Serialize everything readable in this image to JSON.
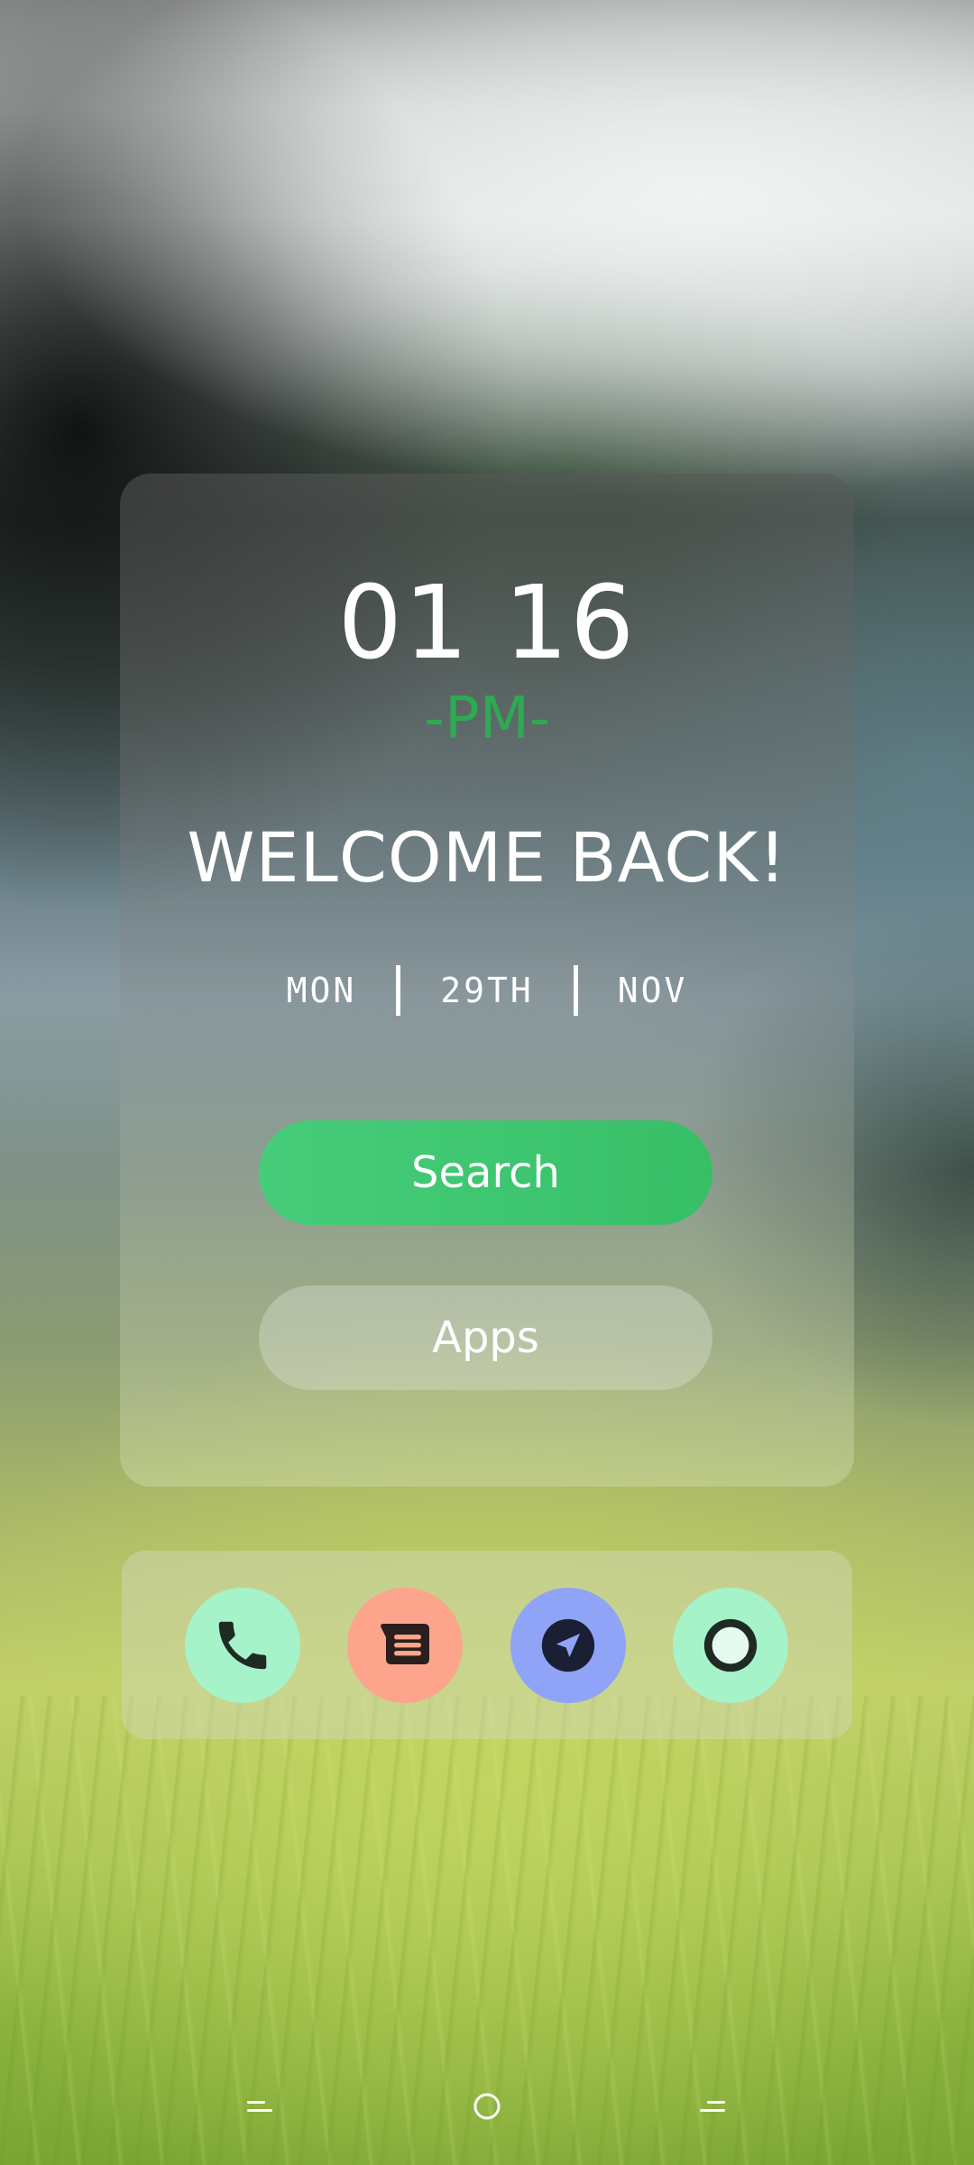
{
  "clock": {
    "time": "01 16",
    "ampm": "-PM-"
  },
  "greeting": "WELCOME BACK!",
  "date": {
    "day": "MON",
    "date": "29TH",
    "month": "NOV"
  },
  "buttons": {
    "search_label": "Search",
    "apps_label": "Apps"
  },
  "dock": {
    "items": [
      {
        "name": "phone-icon",
        "bg": "#a6f2c9"
      },
      {
        "name": "messages-icon",
        "bg": "#fca48c"
      },
      {
        "name": "send-icon",
        "bg": "#8fa4f6"
      },
      {
        "name": "camera-icon",
        "bg": "#a6f2c9"
      }
    ]
  },
  "colors": {
    "accent_green": "#2eaa52",
    "search_button": "#3fc671"
  },
  "navbar": {
    "icons": [
      "back-icon",
      "home-icon",
      "recents-icon"
    ]
  }
}
